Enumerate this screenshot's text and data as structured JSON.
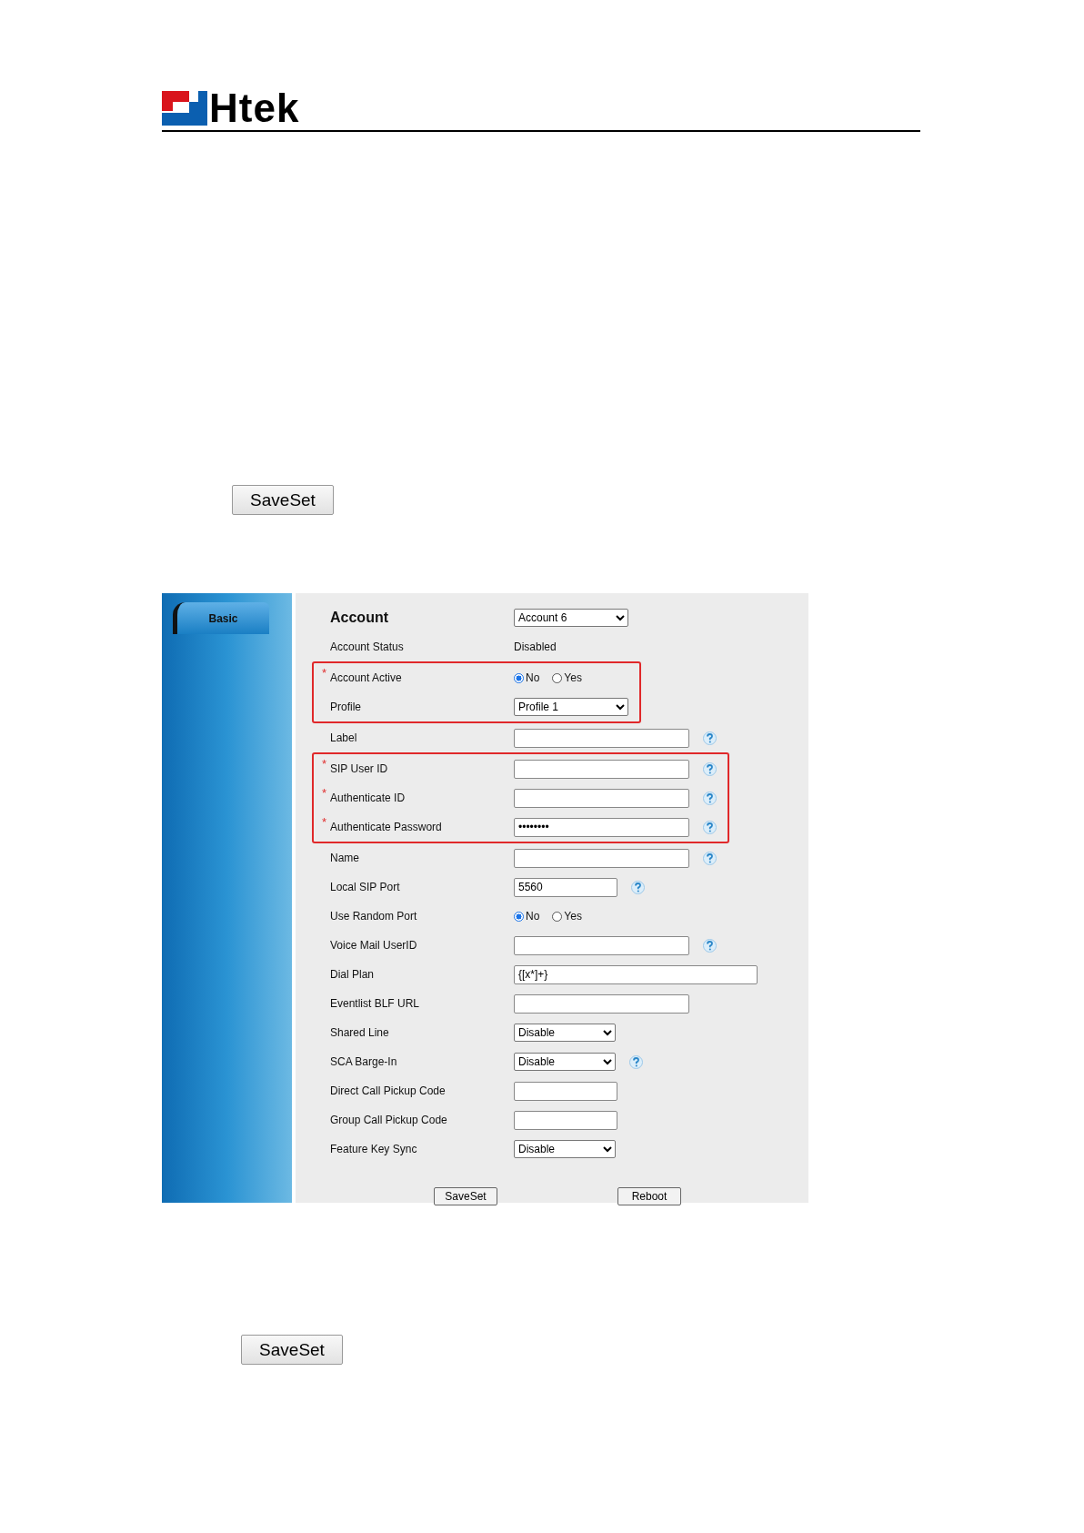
{
  "header": {
    "logo_text": "Htek"
  },
  "top_button": "SaveSet",
  "screenshot": {
    "sidebar": {
      "tabs": [
        {
          "label": "Basic",
          "selected": true
        }
      ]
    },
    "title": "Account",
    "account_select": "Account 6",
    "groups": [
      {
        "highlighted": false,
        "rows": [
          {
            "kind": "text",
            "label": "Account Status",
            "value": "Disabled"
          }
        ]
      },
      {
        "highlighted": true,
        "rows": [
          {
            "kind": "radio",
            "label": "Account Active",
            "marker": "*",
            "options": [
              {
                "label": "No",
                "selected": true
              },
              {
                "label": "Yes",
                "selected": false
              }
            ]
          },
          {
            "kind": "select",
            "label": "Profile",
            "value": "Profile 1"
          }
        ]
      },
      {
        "highlighted": false,
        "rows": [
          {
            "kind": "field",
            "label": "Label",
            "help": true
          }
        ]
      },
      {
        "highlighted": true,
        "rows": [
          {
            "kind": "field",
            "label": "SIP User ID",
            "marker": "*",
            "help": true
          },
          {
            "kind": "field",
            "label": "Authenticate ID",
            "marker": "*",
            "help": true
          },
          {
            "kind": "field",
            "label": "Authenticate Password",
            "marker": "*",
            "value": "••••••••",
            "help": true
          }
        ]
      },
      {
        "highlighted": false,
        "rows": [
          {
            "kind": "field",
            "label": "Name",
            "help": true
          },
          {
            "kind": "short-field",
            "label": "Local SIP Port",
            "value": "5560",
            "help": true
          },
          {
            "kind": "radio",
            "label": "Use Random Port",
            "options": [
              {
                "label": "No",
                "selected": true
              },
              {
                "label": "Yes",
                "selected": false
              }
            ]
          },
          {
            "kind": "field",
            "label": "Voice Mail UserID",
            "help": true
          },
          {
            "kind": "wide-field",
            "label": "Dial Plan",
            "value": "{[x*]+}"
          },
          {
            "kind": "field",
            "label": "Eventlist BLF URL"
          },
          {
            "kind": "small-select",
            "label": "Shared Line",
            "value": "Disable"
          },
          {
            "kind": "small-select",
            "label": "SCA Barge-In",
            "value": "Disable",
            "help": true
          },
          {
            "kind": "short-field",
            "label": "Direct Call Pickup Code"
          },
          {
            "kind": "short-field",
            "label": "Group Call Pickup Code"
          },
          {
            "kind": "small-select",
            "label": "Feature Key Sync",
            "value": "Disable"
          }
        ]
      }
    ],
    "buttons": [
      "SaveSet",
      "Reboot"
    ]
  },
  "bottom_button": "SaveSet"
}
